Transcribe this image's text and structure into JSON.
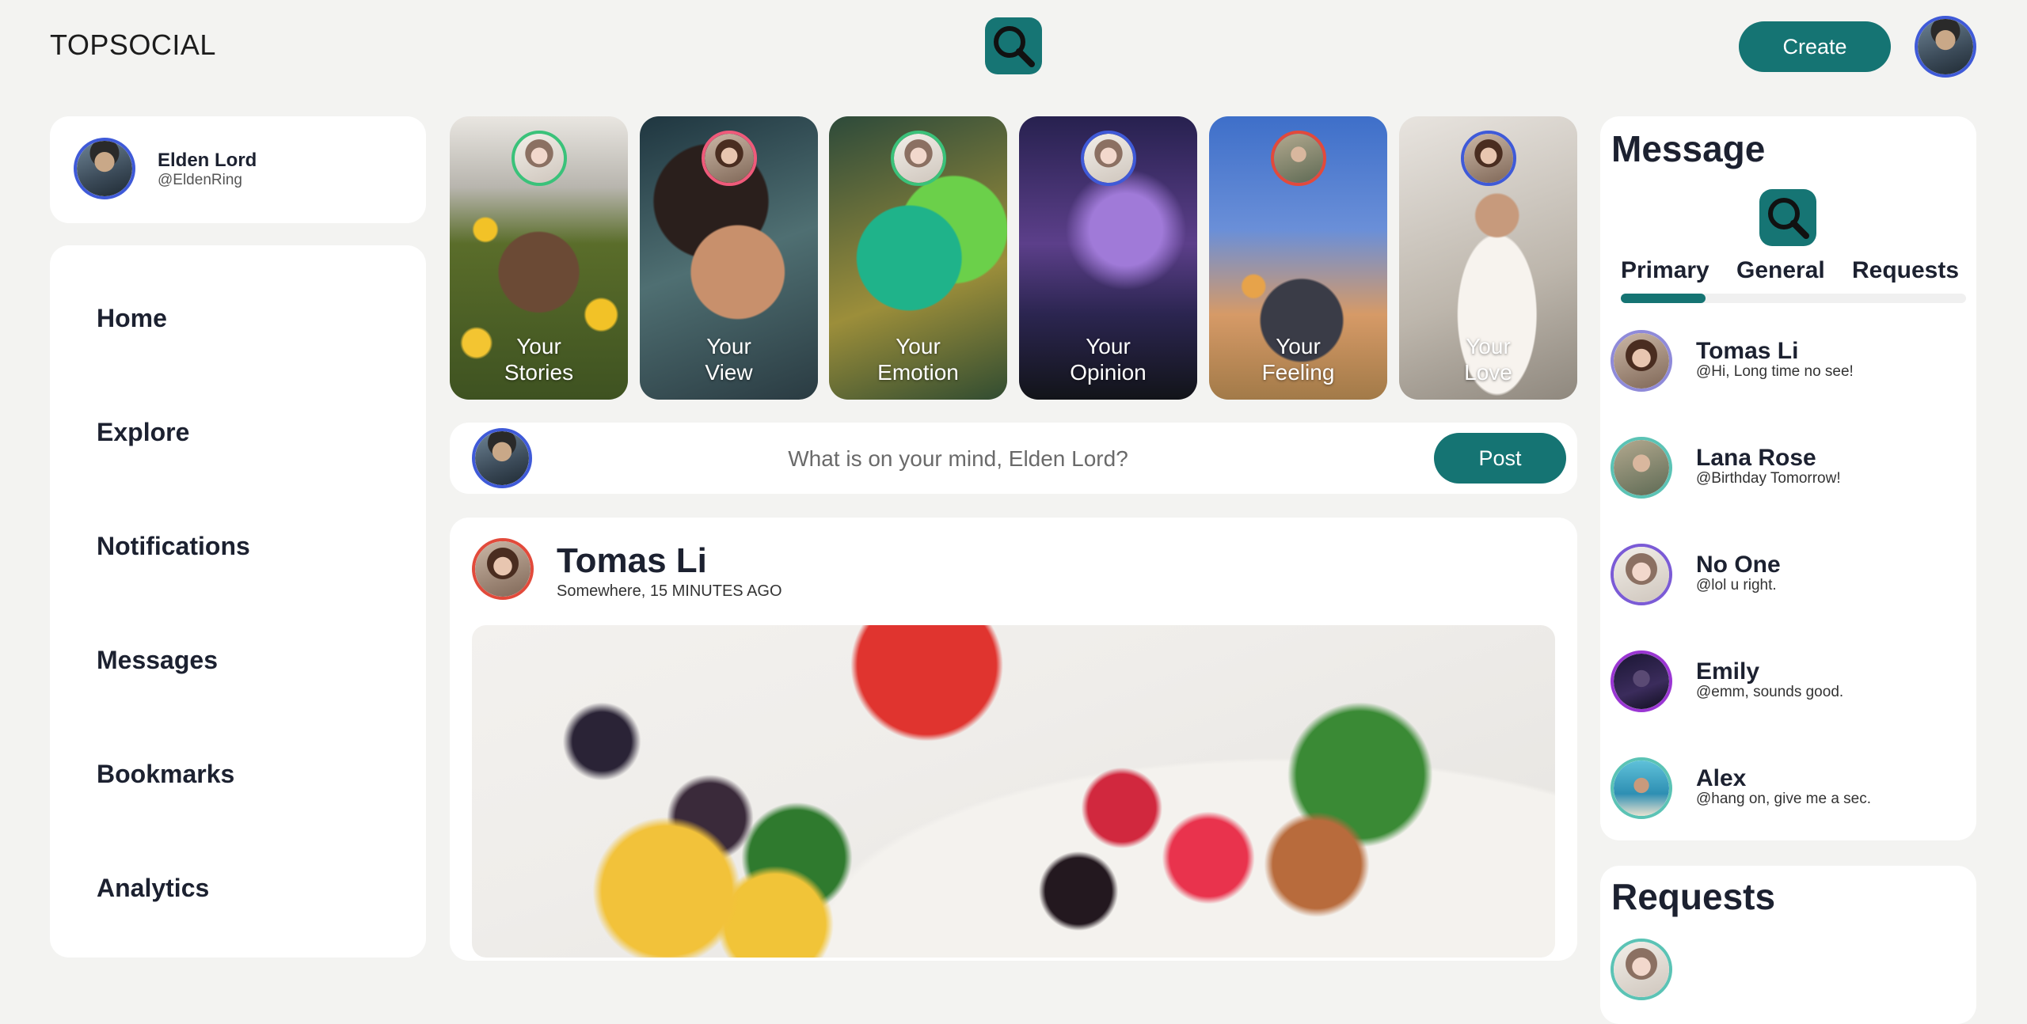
{
  "app": {
    "brand": "TOPSOCIAL",
    "accent": "#157473"
  },
  "header": {
    "search_icon": "search-icon",
    "create_label": "Create",
    "avatar": "user-avatar"
  },
  "profile": {
    "name": "Elden Lord",
    "handle": "@EldenRing"
  },
  "nav": {
    "items": [
      {
        "label": "Home"
      },
      {
        "label": "Explore"
      },
      {
        "label": "Notifications"
      },
      {
        "label": "Messages"
      },
      {
        "label": "Bookmarks"
      },
      {
        "label": "Analytics"
      }
    ]
  },
  "stories": [
    {
      "line1": "Your",
      "line2": "Stories"
    },
    {
      "line1": "Your",
      "line2": "View"
    },
    {
      "line1": "Your",
      "line2": "Emotion"
    },
    {
      "line1": "Your",
      "line2": "Opinion"
    },
    {
      "line1": "Your",
      "line2": "Feeling"
    },
    {
      "line1": "Your",
      "line2": "Love"
    }
  ],
  "compose": {
    "placeholder": "What is on your mind, Elden Lord?",
    "post_label": "Post"
  },
  "feed": {
    "author": "Tomas Li",
    "meta": "Somewhere, 15 MINUTES AGO"
  },
  "messages": {
    "title": "Message",
    "tabs": [
      {
        "label": "Primary"
      },
      {
        "label": "General"
      },
      {
        "label": "Requests"
      }
    ],
    "active_tab": "Primary",
    "items": [
      {
        "name": "Tomas Li",
        "text": "@Hi, Long time no see!"
      },
      {
        "name": "Lana Rose",
        "text": "@Birthday Tomorrow!"
      },
      {
        "name": "No One",
        "text": "@lol u right."
      },
      {
        "name": "Emily",
        "text": "@emm, sounds good."
      },
      {
        "name": "Alex",
        "text": "@hang on, give me a sec."
      }
    ]
  },
  "requests": {
    "title": "Requests"
  }
}
